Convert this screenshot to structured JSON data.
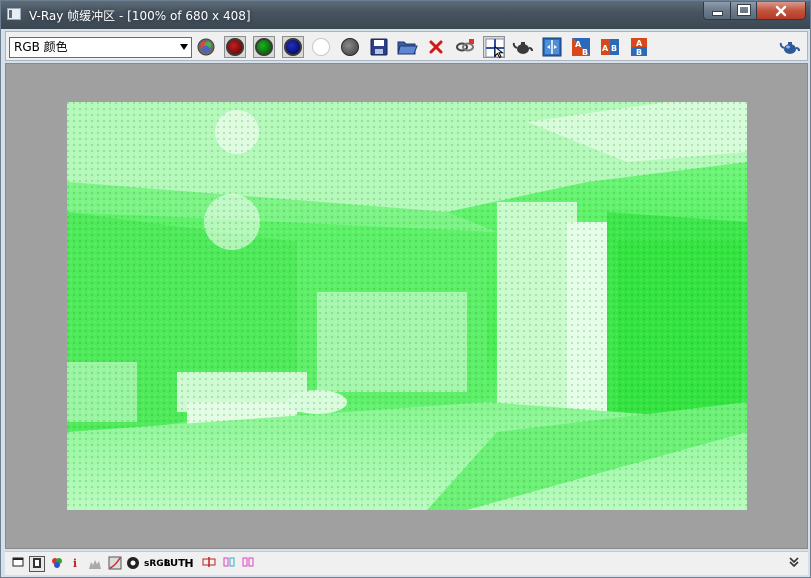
{
  "window": {
    "title": "V-Ray 帧缓冲区 - [100% of 680 x 408]"
  },
  "toolbar": {
    "channel_select": {
      "value": "RGB 颜色"
    },
    "icons": [
      "rgb-channels-icon",
      "red-channel-icon",
      "green-channel-icon",
      "blue-channel-icon",
      "alpha-channel-icon",
      "monochrome-icon",
      "save-icon",
      "open-icon",
      "clear-icon",
      "link-icon",
      "track-mouse-icon",
      "render-teapot-icon",
      "compare-icon",
      "ab-horizontal-icon",
      "ab-split-icon",
      "ab-vertical-icon",
      "render-last-teapot-icon"
    ]
  },
  "status": {
    "info_glyph": "i",
    "srgb_label": "sRGB",
    "lut_label": "LUT",
    "h_label": "H"
  },
  "colors": {
    "render_green": "#5df168",
    "toolbar_bg": "#f0f0f0",
    "viewport_bg": "#a0a0a0"
  }
}
